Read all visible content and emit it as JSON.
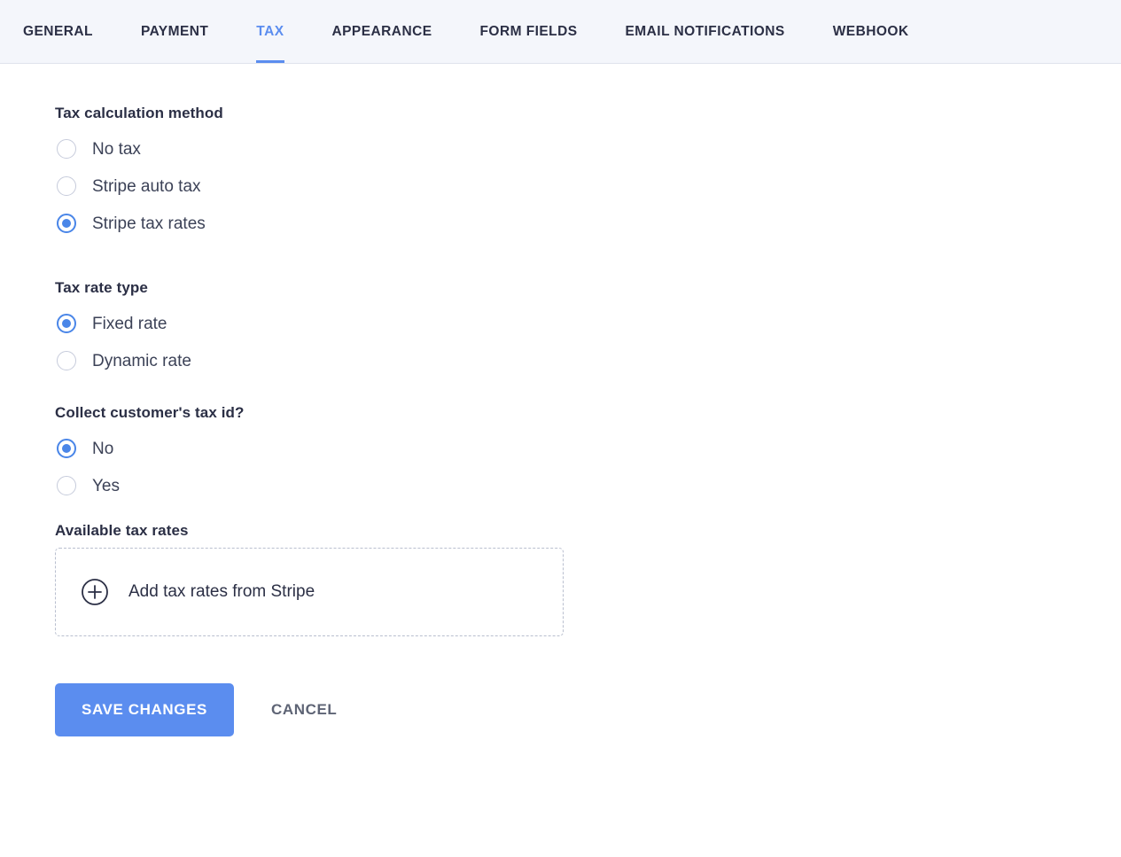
{
  "colors": {
    "accent": "#5b8def",
    "radio_accent": "#4a86e8",
    "heading": "#2b2f45",
    "body_text": "#3c4257",
    "tabbar_bg": "#f4f6fb",
    "muted": "#5e6475",
    "dashed_border": "#b9bfcf"
  },
  "tabs": [
    {
      "label": "GENERAL",
      "active": false
    },
    {
      "label": "PAYMENT",
      "active": false
    },
    {
      "label": "TAX",
      "active": true
    },
    {
      "label": "APPEARANCE",
      "active": false
    },
    {
      "label": "FORM FIELDS",
      "active": false
    },
    {
      "label": "EMAIL NOTIFICATIONS",
      "active": false
    },
    {
      "label": "WEBHOOK",
      "active": false
    }
  ],
  "sections": {
    "tax_calculation_method": {
      "heading": "Tax calculation method",
      "options": [
        {
          "label": "No tax",
          "selected": false
        },
        {
          "label": "Stripe auto tax",
          "selected": false
        },
        {
          "label": "Stripe tax rates",
          "selected": true
        }
      ]
    },
    "tax_rate_type": {
      "heading": "Tax rate type",
      "options": [
        {
          "label": "Fixed rate",
          "selected": true
        },
        {
          "label": "Dynamic rate",
          "selected": false
        }
      ]
    },
    "collect_tax_id": {
      "heading": "Collect customer's tax id?",
      "options": [
        {
          "label": "No",
          "selected": true
        },
        {
          "label": "Yes",
          "selected": false
        }
      ]
    },
    "available_tax_rates": {
      "heading": "Available tax rates",
      "add_label": "Add tax rates from Stripe",
      "add_icon": "plus-circle-icon"
    }
  },
  "actions": {
    "save_label": "SAVE CHANGES",
    "cancel_label": "CANCEL"
  }
}
